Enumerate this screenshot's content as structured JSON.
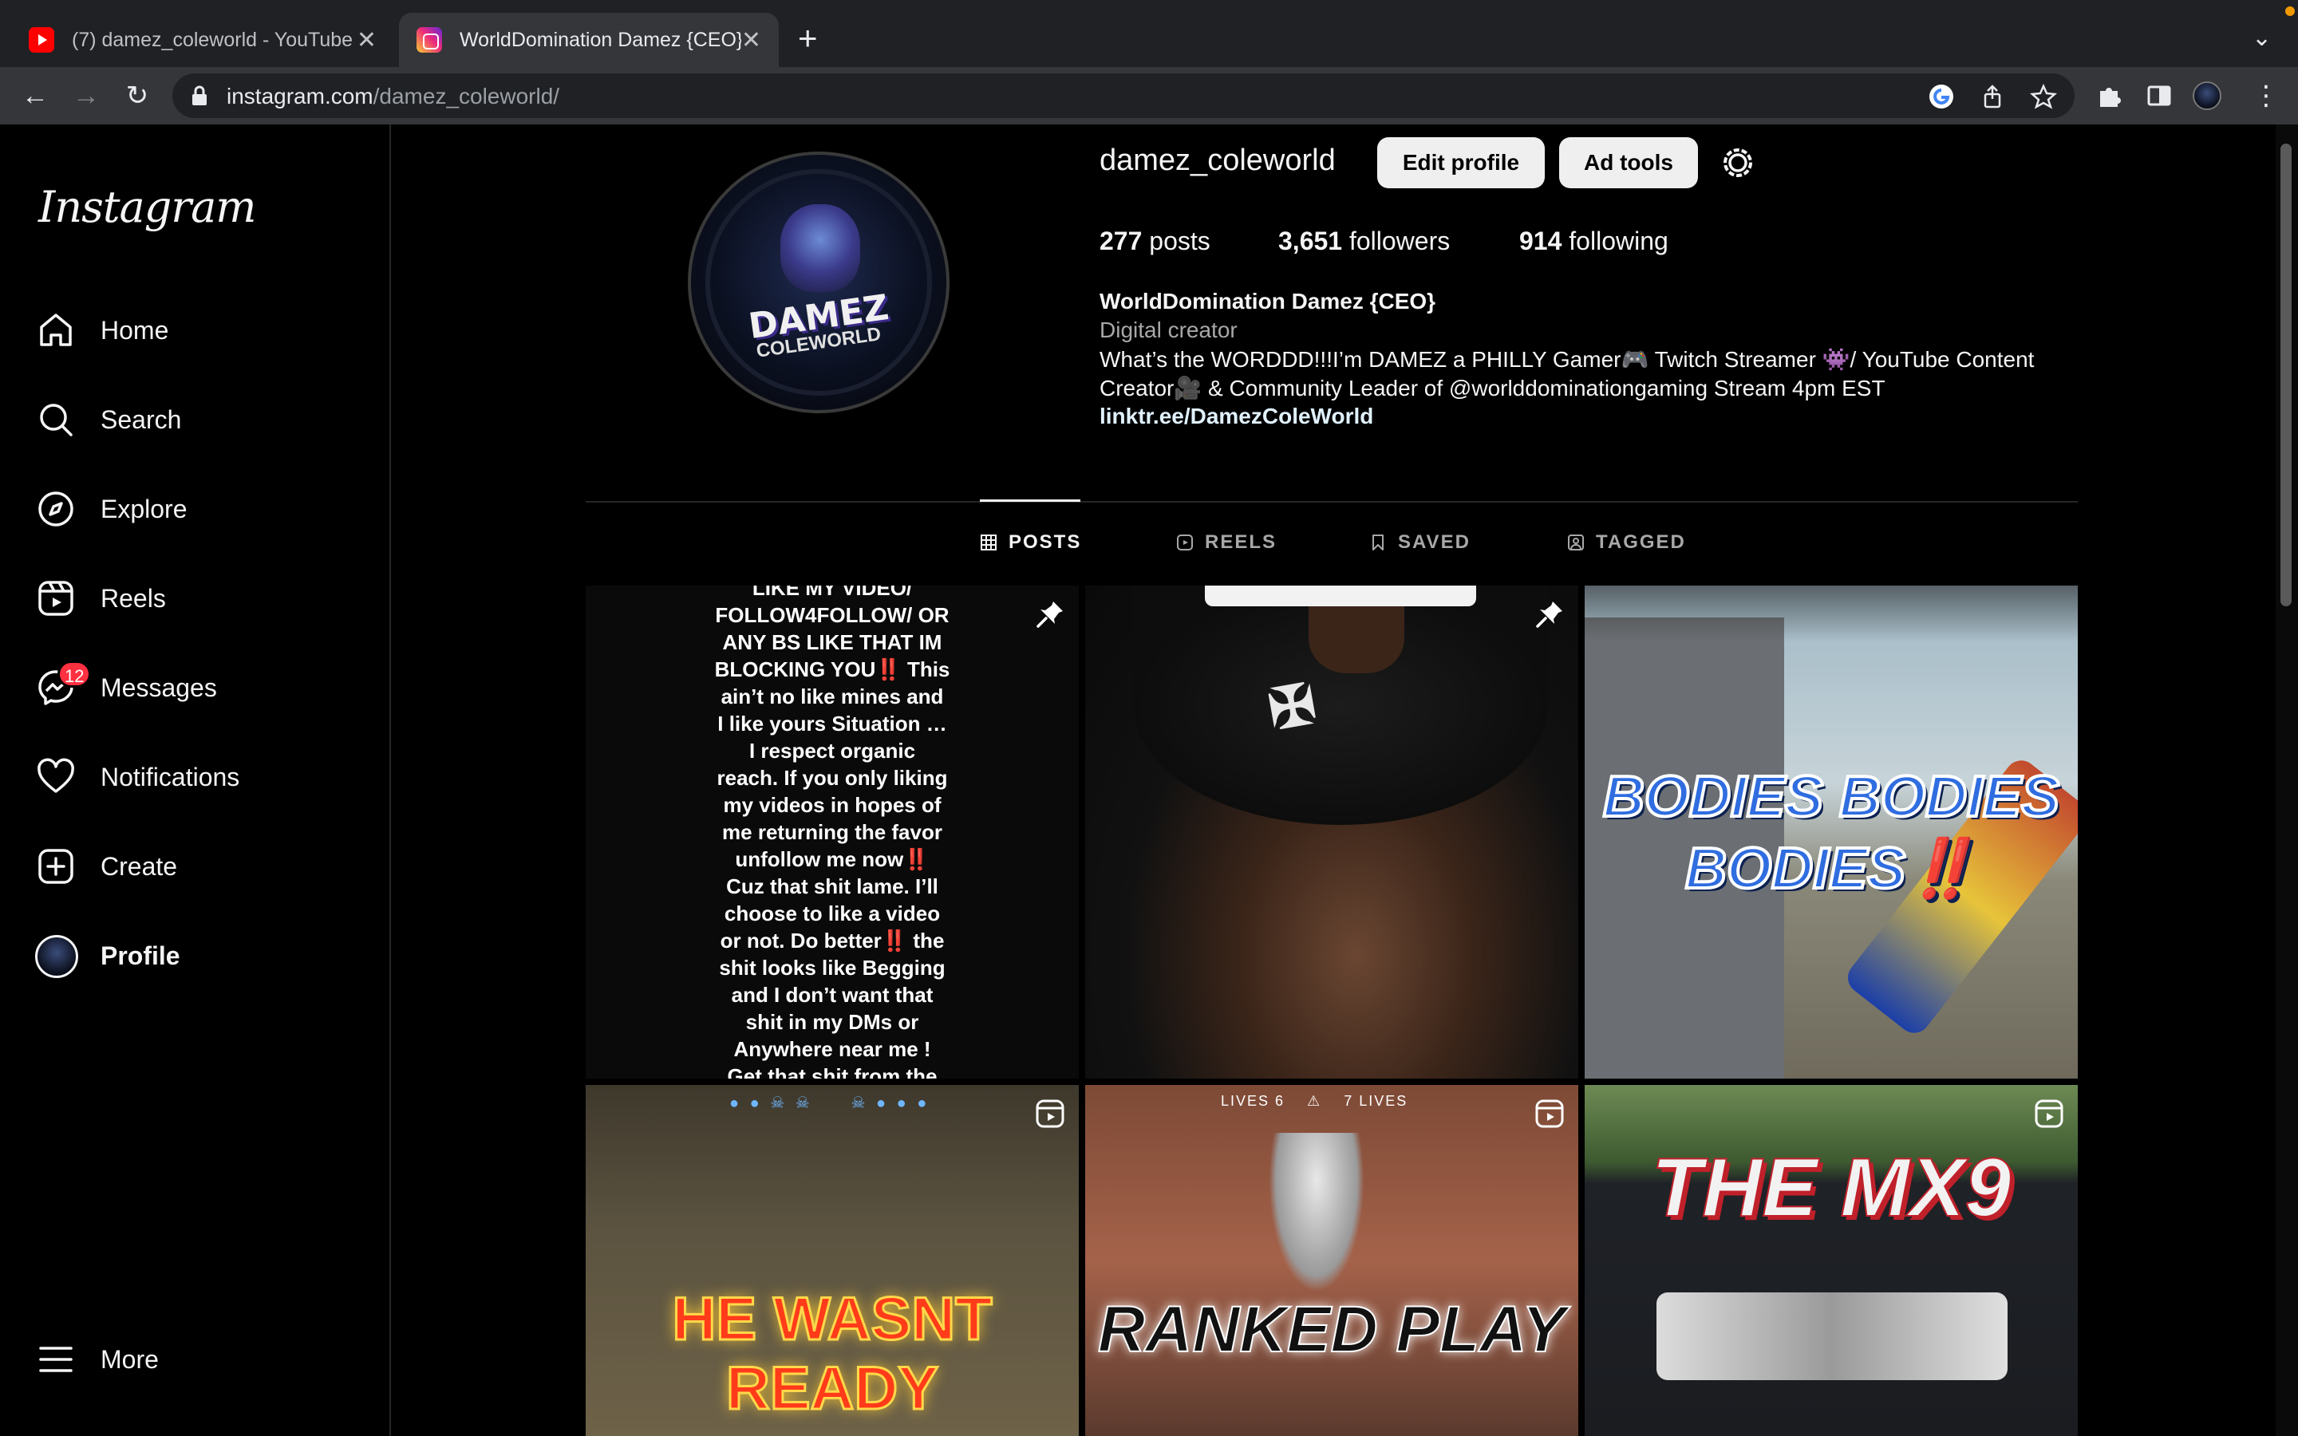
{
  "browser": {
    "tabs": [
      {
        "title": "(7) damez_coleworld - YouTube",
        "favicon": "youtube-icon"
      },
      {
        "title": "WorldDomination Damez {CEO} • Instagram",
        "favicon": "instagram-icon"
      }
    ],
    "url_host": "instagram.com",
    "url_path": "/damez_coleworld/"
  },
  "sidebar": {
    "logo": "Instagram",
    "items": [
      {
        "label": "Home",
        "icon": "home-icon"
      },
      {
        "label": "Search",
        "icon": "search-icon"
      },
      {
        "label": "Explore",
        "icon": "compass-icon"
      },
      {
        "label": "Reels",
        "icon": "reels-icon"
      },
      {
        "label": "Messages",
        "icon": "messenger-icon",
        "badge": "12"
      },
      {
        "label": "Notifications",
        "icon": "heart-icon"
      },
      {
        "label": "Create",
        "icon": "plus-square-icon"
      },
      {
        "label": "Profile",
        "icon": "avatar"
      }
    ],
    "more": "More"
  },
  "profile": {
    "username": "damez_coleworld",
    "edit_button": "Edit profile",
    "ad_button": "Ad tools",
    "posts_count": "277",
    "posts_label": "posts",
    "followers_count": "3,651",
    "followers_label": "followers",
    "following_count": "914",
    "following_label": "following",
    "full_name": "WorldDomination Damez {CEO}",
    "category": "Digital creator",
    "bio_line1": "What’s the WORDDD!!!I’m DAMEZ a PHILLY Gamer🎮 Twitch Streamer 👾/ YouTube Content",
    "bio_line2": "Creator🎥 & Community Leader of @worlddominationgaming Stream 4pm EST",
    "link": "linktr.ee/DamezColeWorld",
    "avatar_text_1": "DAMEZ",
    "avatar_text_2": "COLEWORLD"
  },
  "tabs": {
    "posts": "POSTS",
    "reels": "REELS",
    "saved": "SAVED",
    "tagged": "TAGGED"
  },
  "grid": {
    "post1_lines": [
      "LIKE MY VIDEO/",
      "FOLLOW4FOLLOW/ OR",
      "ANY BS LIKE THAT IM",
      "BLOCKING YOU‼️ This",
      "ain’t no like mines and",
      "I like yours Situation …",
      "I respect organic",
      "reach. If you only liking",
      "my videos in hopes of",
      "me returning the favor",
      "unfollow me now‼️",
      "Cuz that shit lame. I’ll",
      "choose to like a video",
      "or not. Do better‼️ the",
      "shit looks like Begging",
      "and I don’t want that",
      "shit in my DMs or",
      "Anywhere near me !",
      "Get that shit from the"
    ],
    "post3_title_1": "BODIES BODIES",
    "post3_title_2": "BODIES",
    "post3_bang": "‼️",
    "post4_title": "HE WASNT READY",
    "post5_title": "RANKED PLAY",
    "post5_hud_left": "LIVES 6",
    "post5_hud_right": "7 LIVES",
    "post6_title": "THE MX9"
  }
}
